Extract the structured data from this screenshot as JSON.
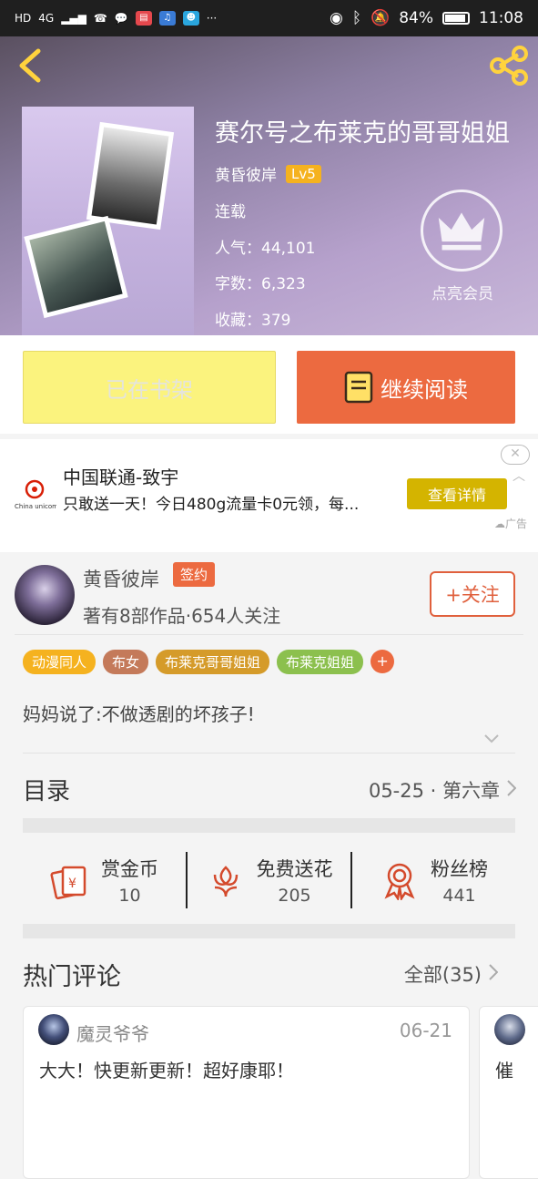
{
  "status_bar": {
    "network": "HD",
    "signal": "4G",
    "battery": "84%",
    "time": "11:08"
  },
  "book": {
    "title": "赛尔号之布莱克的哥哥姐姐",
    "author": "黄昏彼岸",
    "level": "Lv5",
    "status": "连载",
    "popularity": "人气：44,101",
    "word_count": "字数：6,323",
    "favorites": "收藏：379",
    "vip_label": "点亮会员"
  },
  "actions": {
    "shelf_label": "已在书架",
    "read_label": "继续阅读"
  },
  "ad": {
    "brand_logo_text": "China unicom中国联通",
    "title": "中国联通-致宇",
    "desc": "只敢送一天！今日480g流量卡0元领，每...",
    "button": "查看详情",
    "close": "✕",
    "tag": "广告"
  },
  "author_card": {
    "name": "黄昏彼岸",
    "signed_badge": "签约",
    "stats": "著有8部作品·654人关注",
    "follow_label": "+关注"
  },
  "tags": [
    {
      "label": "动漫同人",
      "color": "#f5b21f"
    },
    {
      "label": "布女",
      "color": "#c47a5a"
    },
    {
      "label": "布莱克哥哥姐姐",
      "color": "#d59b2a"
    },
    {
      "label": "布莱克姐姐",
      "color": "#8cc04e"
    }
  ],
  "tag_more": "+",
  "intro": "妈妈说了:不做透剧的坏孩子!",
  "toc": {
    "label": "目录",
    "latest": "05-25 · 第六章"
  },
  "rewards": [
    {
      "title": "赏金币",
      "value": "10",
      "icon": "red-envelope-icon"
    },
    {
      "title": "免费送花",
      "value": "205",
      "icon": "flower-icon"
    },
    {
      "title": "粉丝榜",
      "value": "441",
      "icon": "medal-icon"
    }
  ],
  "comments_section": {
    "title": "热门评论",
    "all_label": "全部(35)"
  },
  "comments": [
    {
      "user": "魔灵爷爷",
      "date": "06-21",
      "text": "大大！快更新更新！超好康耶！"
    },
    {
      "user": "",
      "date": "",
      "text": "催"
    }
  ],
  "colors": {
    "accent": "#ec6a40",
    "shelf_button": "#fbf37e",
    "level_badge": "#f5b21f",
    "ad_button": "#d4b400"
  }
}
